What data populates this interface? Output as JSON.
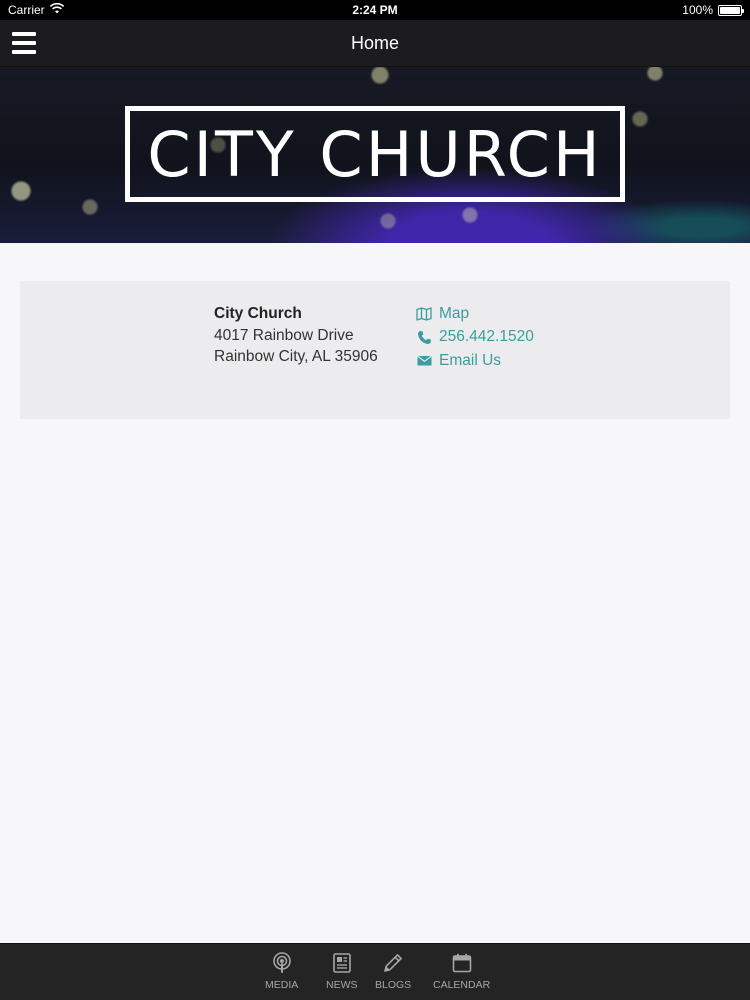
{
  "status_bar": {
    "carrier": "Carrier",
    "time": "2:24 PM",
    "battery": "100%",
    "battery_level": 1.0
  },
  "nav": {
    "title": "Home",
    "menu_icon": "hamburger-menu-icon"
  },
  "hero": {
    "logo_text": "CITY CHURCH"
  },
  "info": {
    "name": "City Church",
    "address_line1": "4017 Rainbow Drive",
    "address_line2": "Rainbow City, AL 35906",
    "links": [
      {
        "label": "Map",
        "icon": "map-icon"
      },
      {
        "label": "256.442.1520",
        "icon": "phone-icon"
      },
      {
        "label": "Email Us",
        "icon": "envelope-icon"
      }
    ]
  },
  "tab_bar": {
    "tabs": [
      {
        "label": "MEDIA",
        "icon": "podcast-icon"
      },
      {
        "label": "NEWS",
        "icon": "news-icon"
      },
      {
        "label": "BLOGS",
        "icon": "pencil-icon"
      },
      {
        "label": "CALENDAR",
        "icon": "calendar-icon"
      }
    ]
  },
  "colors": {
    "accent": "#3b9d9f",
    "nav_bg": "#1c1c1e",
    "tab_bar_bg": "#242424",
    "card_bg": "#ececee"
  }
}
